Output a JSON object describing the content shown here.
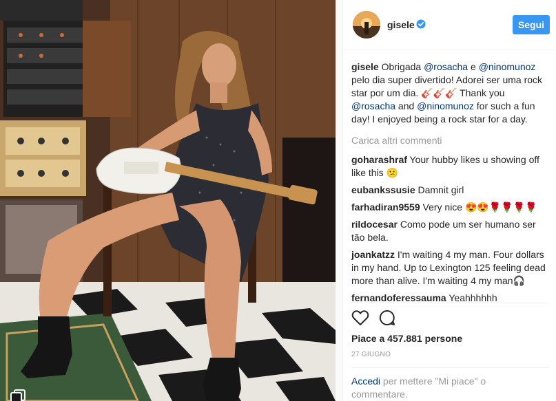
{
  "post": {
    "username": "gisele",
    "follow_label": "Segui",
    "caption": {
      "username": "gisele",
      "parts": [
        {
          "text": " Obrigada ",
          "mention": false
        },
        {
          "text": "@rosacha",
          "mention": true
        },
        {
          "text": " e ",
          "mention": false
        },
        {
          "text": "@ninomunoz",
          "mention": true
        },
        {
          "text": " pelo dia super divertido! Adorei ser uma rock star por um dia. 🎸🎸🎸 Thank you ",
          "mention": false
        },
        {
          "text": "@rosacha",
          "mention": true
        },
        {
          "text": " and ",
          "mention": false
        },
        {
          "text": "@ninomunoz",
          "mention": true
        },
        {
          "text": " for such a fun day! I enjoyed being a rock star for a day.",
          "mention": false
        }
      ]
    },
    "load_more": "Carica altri commenti",
    "comments": [
      {
        "user": "goharashraf",
        "text": " Your hubby likes u showing off like this 😕"
      },
      {
        "user": "eubankssusie",
        "text": " Damnit girl"
      },
      {
        "user": "farhadiran9559",
        "text": " Very nice 😍😍🌹🌹🌹🌹"
      },
      {
        "user": "rildocesar",
        "text": " Como pode um ser humano ser tão bela."
      },
      {
        "user": "joankatzz",
        "text": " I'm waiting 4 my man. Four dollars in my hand. Up to Lexington 125 feeling dead more than alive. I'm waiting 4 my man🎧"
      },
      {
        "user": "fernandoferessauma",
        "text": " Yeahhhhhh"
      }
    ],
    "likes": "Piace a 457.881 persone",
    "date": "27 GIUGNO",
    "login_link": "Accedi",
    "login_text": " per mettere \"Mi piace\" o commentare."
  },
  "icons": {
    "verified": "verified-badge-icon",
    "like": "heart-icon",
    "comment": "comment-bubble-icon",
    "multi": "multiple-photos-icon"
  },
  "colors": {
    "accent": "#3897f0",
    "mention": "#003569",
    "muted": "#999999"
  }
}
